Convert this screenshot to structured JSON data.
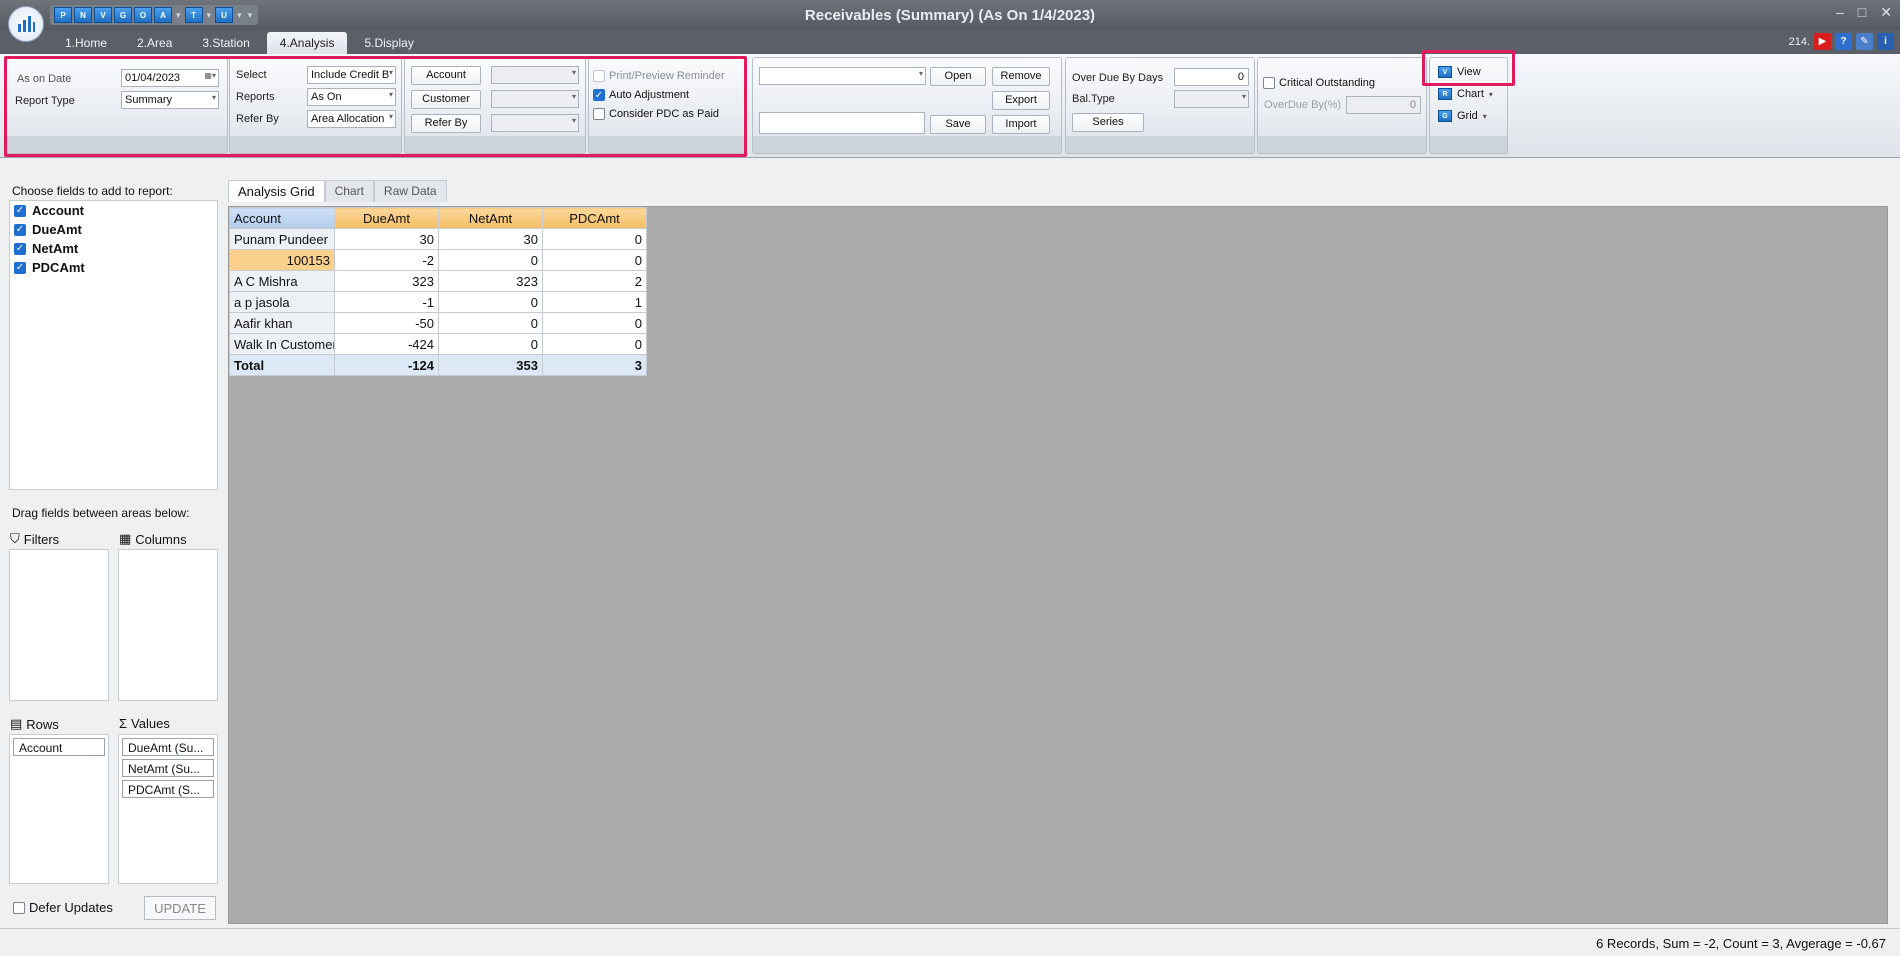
{
  "window": {
    "title": "Receivables (Summary) (As On 1/4/2023)",
    "minimize": "–",
    "maximize": "□",
    "close": "✕"
  },
  "qat": [
    "P",
    "N",
    "V",
    "G",
    "O",
    "A",
    "T",
    "U"
  ],
  "tabs": [
    "1.Home",
    "2.Area",
    "3.Station",
    "4.Analysis",
    "5.Display"
  ],
  "active_tab": "4.Analysis",
  "top_right": {
    "counter": "214."
  },
  "ribbon": {
    "date_group": {
      "as_on_date_label": "As on Date",
      "as_on_date_value": "01/04/2023",
      "report_type_label": "Report Type",
      "report_type_value": "Summary"
    },
    "select_group": {
      "select_label": "Select",
      "select_value": "Include Credit B",
      "reports_label": "Reports",
      "reports_value": "As On",
      "refer_by_label": "Refer By",
      "refer_by_value": "Area Allocation"
    },
    "filter_group": {
      "account_button": "Account",
      "customer_button": "Customer",
      "refer_by_button": "Refer By"
    },
    "options_group": {
      "print_preview": "Print/Preview Reminder",
      "auto_adjustment": "Auto Adjustment",
      "consider_pdc": "Consider PDC as Paid"
    },
    "layout_group": {
      "open": "Open",
      "remove": "Remove",
      "export": "Export",
      "save": "Save",
      "import": "Import"
    },
    "overdue_group": {
      "over_due_label": "Over Due By Days",
      "over_due_value": "0",
      "bal_type_label": "Bal.Type",
      "series_button": "Series"
    },
    "critical_group": {
      "critical_label": "Critical Outstanding",
      "overdue_pct_label": "OverDue By(%)",
      "overdue_pct_value": "0"
    },
    "view_group": {
      "view": "View",
      "chart": "Chart",
      "grid": "Grid"
    }
  },
  "field_list": {
    "title": "Choose fields to add to report:",
    "fields": [
      "Account",
      "DueAmt",
      "NetAmt",
      "PDCAmt"
    ],
    "drag_hint": "Drag fields between areas below:",
    "filters_label": "Filters",
    "columns_label": "Columns",
    "rows_label": "Rows",
    "values_label": "Values",
    "rows_items": [
      "Account"
    ],
    "values_items": [
      "DueAmt (Su...",
      "NetAmt (Su...",
      "PDCAmt (S..."
    ],
    "defer_updates": "Defer Updates",
    "update_button": "UPDATE"
  },
  "main_tabs": [
    "Analysis Grid",
    "Chart",
    "Raw Data"
  ],
  "grid": {
    "headers": [
      "Account",
      "DueAmt",
      "NetAmt",
      "PDCAmt"
    ],
    "rows": [
      [
        "Punam Pundeer",
        "30",
        "30",
        "0"
      ],
      [
        "100153",
        "-2",
        "0",
        "0"
      ],
      [
        "A C Mishra",
        "323",
        "323",
        "2"
      ],
      [
        "a p jasola",
        "-1",
        "0",
        "1"
      ],
      [
        "Aafir khan",
        "-50",
        "0",
        "0"
      ],
      [
        "Walk In Customer",
        "-424",
        "0",
        "0"
      ]
    ],
    "total": [
      "Total",
      "-124",
      "353",
      "3"
    ]
  },
  "status": "6 Records, Sum = -2, Count = 3, Avgerage = -0.67",
  "colors": {
    "accent": "#1f6fd0",
    "highlight": "#e2195b",
    "header_orange": "#f5be64",
    "row_header_blue": "#b3cdee"
  }
}
